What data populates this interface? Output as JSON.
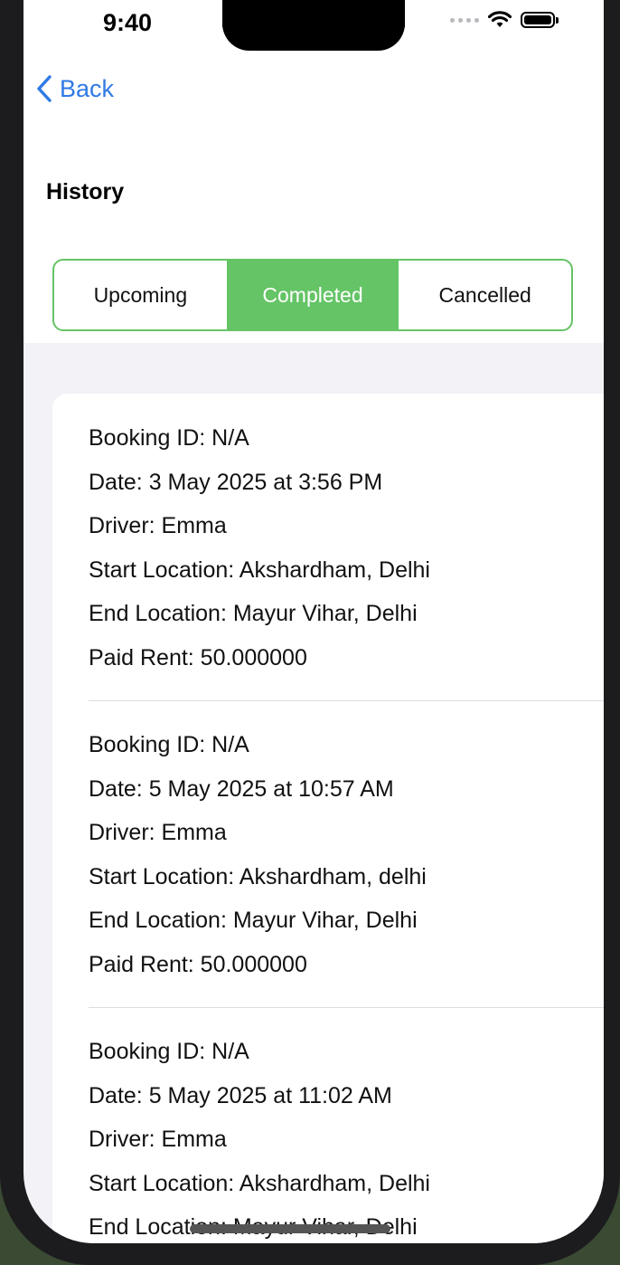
{
  "status_bar": {
    "time": "9:40"
  },
  "nav": {
    "back_label": "Back"
  },
  "page": {
    "title": "History"
  },
  "tabs": [
    {
      "label": "Upcoming",
      "active": false
    },
    {
      "label": "Completed",
      "active": true
    },
    {
      "label": "Cancelled",
      "active": false
    }
  ],
  "colors": {
    "accent_green": "#65c466",
    "link_blue": "#2f7ae5",
    "background": "#f2f2f7"
  },
  "bookings": [
    {
      "booking_id": "Booking ID: N/A",
      "date": "Date: 3 May 2025 at 3:56 PM",
      "driver": "Driver: Emma",
      "start": "Start Location: Akshardham, Delhi",
      "end": "End Location: Mayur Vihar, Delhi",
      "rent": "Paid Rent: 50.000000"
    },
    {
      "booking_id": "Booking ID: N/A",
      "date": "Date: 5 May 2025 at 10:57 AM",
      "driver": "Driver: Emma",
      "start": "Start Location: Akshardham, delhi",
      "end": "End Location: Mayur Vihar, Delhi",
      "rent": "Paid Rent: 50.000000"
    },
    {
      "booking_id": "Booking ID: N/A",
      "date": "Date: 5 May 2025 at 11:02 AM",
      "driver": "Driver: Emma",
      "start": "Start Location: Akshardham, Delhi",
      "end": "End Location: Mayur Vihar, Delhi"
    }
  ]
}
